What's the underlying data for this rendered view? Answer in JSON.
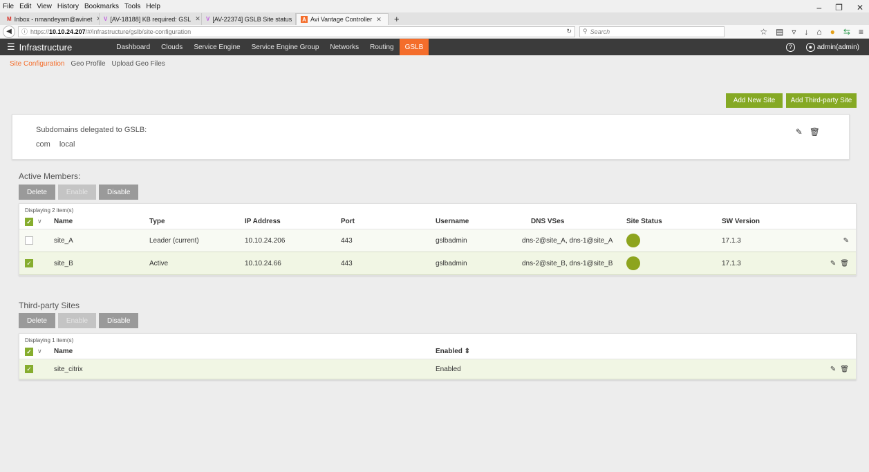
{
  "browser": {
    "menu": [
      "File",
      "Edit",
      "View",
      "History",
      "Bookmarks",
      "Tools",
      "Help"
    ],
    "window_controls": [
      "–",
      "❐",
      "✕"
    ],
    "tabs": [
      {
        "icon": "M",
        "icon_color": "#d93025",
        "label": "Inbox - nmandeyam@avinet",
        "active": false
      },
      {
        "icon": "V",
        "icon_color": "#c05de0",
        "label": "[AV-18188] KB required: GSL",
        "active": false
      },
      {
        "icon": "V",
        "icon_color": "#c05de0",
        "label": "[AV-22374] GSLB Site status",
        "active": false
      },
      {
        "icon": "A",
        "icon_color": "#f46d2b",
        "label": "Avi Vantage Controller",
        "active": true
      }
    ],
    "url_prefix": "https://",
    "url_host": "10.10.24.207",
    "url_path": "/#/infrastructure/gslb/site-configuration",
    "search_placeholder": "Search"
  },
  "nav": {
    "section": "Infrastructure",
    "items": [
      "Dashboard",
      "Clouds",
      "Service Engine",
      "Service Engine Group",
      "Networks",
      "Routing",
      "GSLB"
    ],
    "active": "GSLB",
    "help": "?",
    "user": "admin(admin)"
  },
  "subnav": [
    "Site Configuration",
    "Geo Profile",
    "Upload Geo Files"
  ],
  "actions": {
    "add_new_site": "Add New Site",
    "add_third_party": "Add Third-party Site"
  },
  "subdomains": {
    "label": "Subdomains delegated to GSLB:",
    "values": [
      "com",
      "local"
    ]
  },
  "active_members": {
    "title": "Active Members:",
    "buttons": {
      "delete": "Delete",
      "enable": "Enable",
      "disable": "Disable"
    },
    "count": "Displaying 2 item(s)",
    "columns": [
      "Name",
      "Type",
      "IP Address",
      "Port",
      "Username",
      "DNS VSes",
      "Site Status",
      "SW Version"
    ],
    "rows": [
      {
        "checked": false,
        "name": "site_A",
        "type": "Leader (current)",
        "ip": "10.10.24.206",
        "port": "443",
        "username": "gslbadmin",
        "dns": "dns-2@site_A, dns-1@site_A",
        "status_color": "#8da41e",
        "version": "17.1.3"
      },
      {
        "checked": true,
        "name": "site_B",
        "type": "Active",
        "ip": "10.10.24.66",
        "port": "443",
        "username": "gslbadmin",
        "dns": "dns-2@site_B, dns-1@site_B",
        "status_color": "#8da41e",
        "version": "17.1.3"
      }
    ]
  },
  "third_party": {
    "title": "Third-party Sites",
    "buttons": {
      "delete": "Delete",
      "enable": "Enable",
      "disable": "Disable"
    },
    "count": "Displaying 1 item(s)",
    "columns": [
      "Name",
      "Enabled ⇕"
    ],
    "rows": [
      {
        "checked": true,
        "name": "site_citrix",
        "enabled": "Enabled"
      }
    ]
  }
}
